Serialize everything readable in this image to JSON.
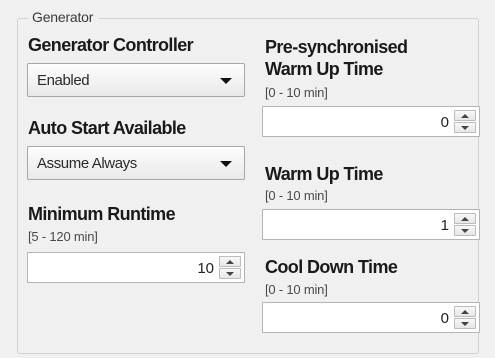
{
  "group": {
    "title": "Generator"
  },
  "left": {
    "controller": {
      "label": "Generator Controller",
      "value": "Enabled"
    },
    "auto_start": {
      "label": "Auto Start Available",
      "value": "Assume Always"
    },
    "min_runtime": {
      "label": "Minimum Runtime",
      "range": "[5 - 120 min]",
      "value": "10"
    }
  },
  "right": {
    "presync": {
      "label_line1": "Pre-synchronised",
      "label_line2": "Warm Up Time",
      "range": "[0 - 10 min]",
      "value": "0"
    },
    "warm_up": {
      "label": "Warm Up Time",
      "range": "[0 - 10 min]",
      "value": "1"
    },
    "cool_down": {
      "label": "Cool Down Time",
      "range": "[0 - 10 min]",
      "value": "0"
    }
  }
}
